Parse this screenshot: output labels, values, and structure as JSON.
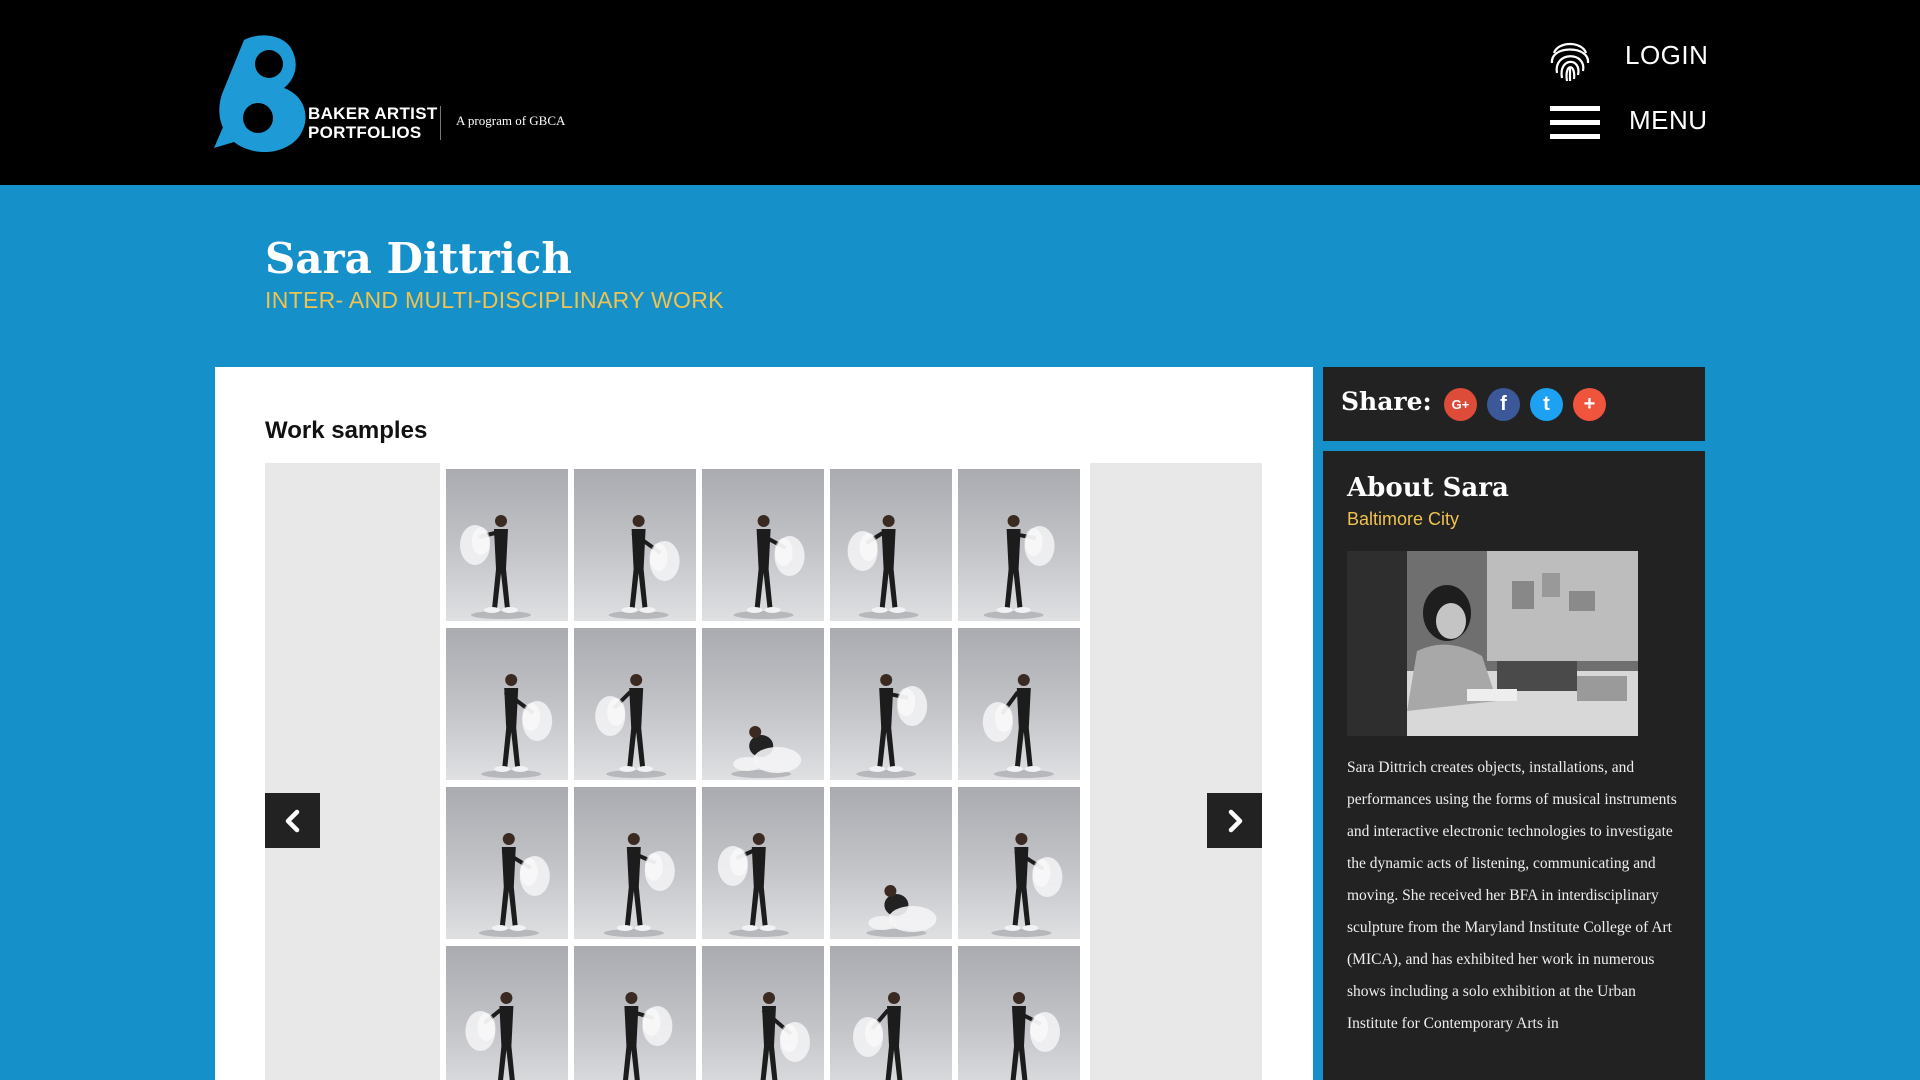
{
  "header": {
    "logo_line1": "BAKER ARTIST",
    "logo_line2": "PORTFOLIOS",
    "tagline": "A program of GBCA",
    "login_label": "LOGIN",
    "menu_label": "MENU",
    "logo_color": "#1e9ad6"
  },
  "hero": {
    "artist_name": "Sara Dittrich",
    "discipline": "INTER- AND MULTI-DISCIPLINARY WORK"
  },
  "work_samples": {
    "title": "Work samples",
    "prev_icon": "chevron-left-icon",
    "next_icon": "chevron-right-icon",
    "thumbnails": [
      "dancer-photo",
      "dancer-photo",
      "dancer-photo",
      "dancer-photo",
      "dancer-photo",
      "dancer-photo",
      "dancer-photo",
      "dancer-photo",
      "dancer-photo",
      "dancer-photo",
      "dancer-photo",
      "dancer-photo",
      "dancer-photo",
      "dancer-photo",
      "dancer-photo",
      "dancer-photo",
      "dancer-photo",
      "dancer-photo",
      "dancer-photo",
      "dancer-photo"
    ]
  },
  "share": {
    "label": "Share:",
    "buttons": [
      {
        "name": "google-plus",
        "glyph": "G+",
        "color": "#dd4b39"
      },
      {
        "name": "facebook",
        "glyph": "f",
        "color": "#3b5998"
      },
      {
        "name": "twitter",
        "glyph": "t",
        "color": "#1da1f2"
      },
      {
        "name": "more",
        "glyph": "+",
        "color": "#f0543c"
      }
    ]
  },
  "about": {
    "title": "About Sara",
    "location": "Baltimore City",
    "bio": "Sara Dittrich creates objects, installations, and performances using the forms of musical instruments and interactive electronic technologies to investigate the dynamic acts of listening, communicating and moving. She received her BFA in interdisciplinary sculpture from the Maryland Institute College of Art (MICA), and has exhibited her work in numerous shows including a solo exhibition at the Urban Institute for Contemporary Arts in"
  },
  "colors": {
    "page_blue": "#1590c9",
    "accent_gold": "#f0c24f",
    "dark_panel": "#222222"
  }
}
